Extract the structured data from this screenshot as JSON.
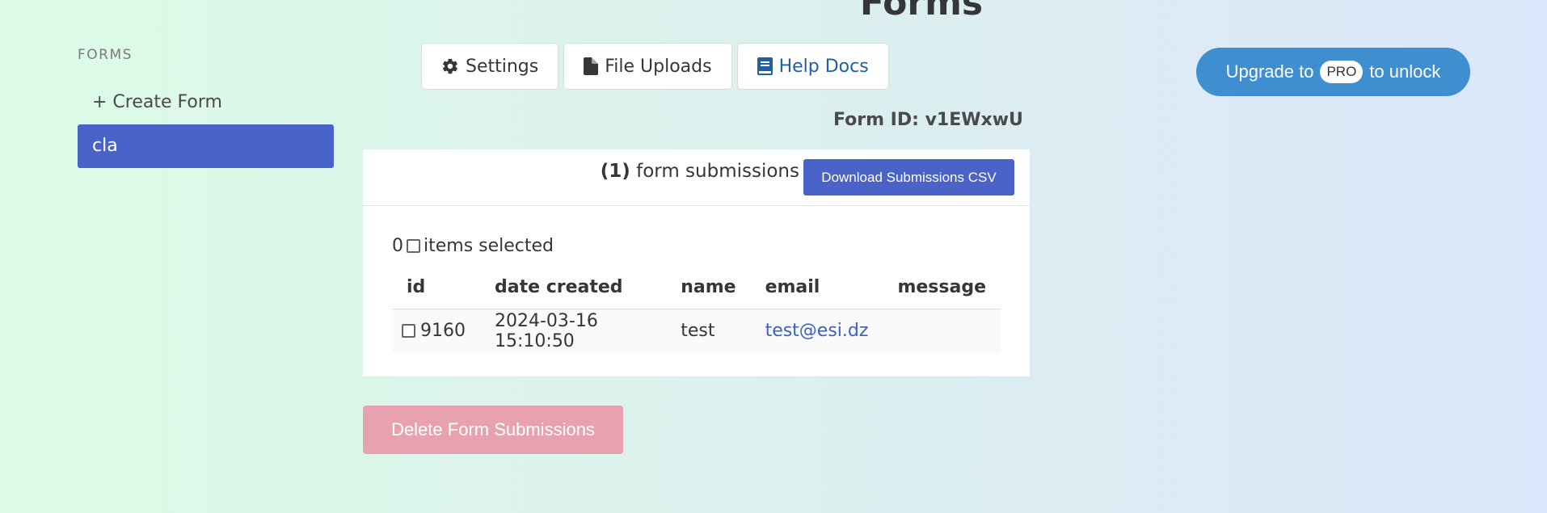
{
  "header": {
    "title": "Forms"
  },
  "sidebar": {
    "section_label": "FORMS",
    "items": [
      {
        "label": "+ Create Form"
      },
      {
        "label": "cla",
        "active": true
      }
    ]
  },
  "tabs": [
    {
      "label": "Settings",
      "icon": "gear-icon"
    },
    {
      "label": "File Uploads",
      "icon": "file-icon"
    },
    {
      "label": "Help Docs",
      "icon": "book-icon"
    }
  ],
  "upgrade": {
    "prefix": "Upgrade to",
    "badge": "PRO",
    "suffix": "to unlock"
  },
  "form_id": {
    "label": "Form ID: v1EWxwU"
  },
  "submissions": {
    "count": "(1)",
    "count_label": "form submissions",
    "download_label": "Download Submissions CSV",
    "selected_count": "0",
    "selected_label": "items selected",
    "columns": [
      "id",
      "date created",
      "name",
      "email",
      "message"
    ],
    "rows": [
      {
        "id": "9160",
        "date_created": "2024-03-16 15:10:50",
        "name": "test",
        "email": "test@esi.dz",
        "message": ""
      }
    ]
  },
  "actions": {
    "delete_label": "Delete Form Submissions"
  },
  "colors": {
    "accent": "#4963c9",
    "upgrade": "#3e8ed0",
    "delete": "#e8a1ae",
    "link": "#3b5fc5"
  }
}
